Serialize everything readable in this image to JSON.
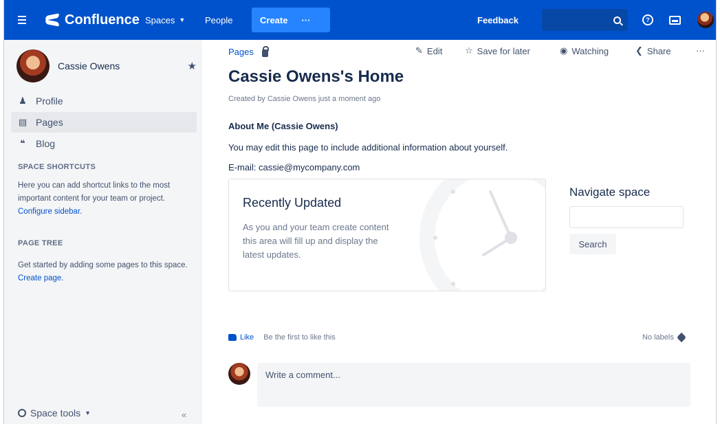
{
  "topnav": {
    "logo_text": "Confluence",
    "spaces_label": "Spaces",
    "people_label": "People",
    "create_label": "Create",
    "more_label": "···",
    "feedback_label": "Feedback",
    "help_glyph": "?",
    "colors": {
      "bar": "#0052cc",
      "create": "#2684ff",
      "search_bg": "#0747a6"
    }
  },
  "sidebar": {
    "profile_name": "Cassie Owens",
    "items": [
      {
        "label": "Profile",
        "icon": "person-icon"
      },
      {
        "label": "Pages",
        "icon": "pages-icon",
        "active": true
      },
      {
        "label": "Blog",
        "icon": "quote-icon"
      }
    ],
    "shortcuts_heading": "SPACE SHORTCUTS",
    "shortcuts_text": "Here you can add shortcut links to the most important content for your team or project.",
    "shortcuts_link": "Configure sidebar.",
    "tree_heading": "PAGE TREE",
    "tree_text": "Get started by adding some pages to this space.",
    "tree_link": "Create page.",
    "space_tools_label": "Space tools",
    "collapse_glyph": "«"
  },
  "main": {
    "breadcrumb": "Pages",
    "actions": {
      "edit": "Edit",
      "save": "Save for later",
      "watch": "Watching",
      "share": "Share",
      "more": "···"
    },
    "title": "Cassie Owens's Home",
    "byline": "Created by Cassie Owens just a moment ago",
    "about_heading": "About Me (Cassie Owens)",
    "about_text": "You may edit this page to include additional information about yourself.",
    "email_text": "E-mail: cassie@mycompany.com",
    "card": {
      "title": "Recently Updated",
      "body": "As you and your team create content this area will fill up and display the latest updates."
    },
    "navigate": {
      "title": "Navigate space",
      "input_value": "",
      "button": "Search"
    },
    "like_label": "Like",
    "like_note": "Be the first to like this",
    "labels_text": "No labels",
    "comment_placeholder": "Write a comment..."
  }
}
